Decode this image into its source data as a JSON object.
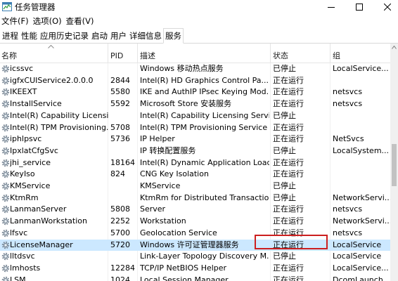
{
  "window": {
    "title": "任务管理器",
    "app_icon": "task-manager-icon",
    "controls": [
      "minimize-icon",
      "maximize-icon",
      "close-icon"
    ]
  },
  "menu": [
    "文件(F)",
    "选项(O)",
    "查看(V)"
  ],
  "tabs": [
    {
      "label": "进程",
      "active": false
    },
    {
      "label": "性能",
      "active": false
    },
    {
      "label": "应用历史记录",
      "active": false
    },
    {
      "label": "启动",
      "active": false
    },
    {
      "label": "用户",
      "active": false
    },
    {
      "label": "详细信息",
      "active": false
    },
    {
      "label": "服务",
      "active": true
    }
  ],
  "columns": {
    "name": "名称",
    "pid": "PID",
    "description": "描述",
    "status": "状态",
    "group": "组",
    "sorted_column": "name"
  },
  "rows": [
    {
      "name": "icssvc",
      "pid": "",
      "description": "Windows 移动热点服务",
      "status": "已停止",
      "group": "LocalService..."
    },
    {
      "name": "igfxCUIService2.0.0.0",
      "pid": "2844",
      "description": "Intel(R) HD Graphics Control Pa...",
      "status": "正在运行",
      "group": ""
    },
    {
      "name": "IKEEXT",
      "pid": "5580",
      "description": "IKE and AuthIP IPsec Keying Mod...",
      "status": "正在运行",
      "group": "netsvcs"
    },
    {
      "name": "InstallService",
      "pid": "5592",
      "description": "Microsoft Store 安装服务",
      "status": "正在运行",
      "group": "netsvcs"
    },
    {
      "name": "Intel(R) Capability Licensi...",
      "pid": "",
      "description": "Intel(R) Capability Licensing Servi...",
      "status": "已停止",
      "group": ""
    },
    {
      "name": "Intel(R) TPM Provisioning...",
      "pid": "5708",
      "description": "Intel(R) TPM Provisioning Service",
      "status": "正在运行",
      "group": ""
    },
    {
      "name": "iphlpsvc",
      "pid": "5736",
      "description": "IP Helper",
      "status": "正在运行",
      "group": "NetSvcs"
    },
    {
      "name": "IpxlatCfgSvc",
      "pid": "",
      "description": "IP 转换配置服务",
      "status": "已停止",
      "group": "LocalSystem..."
    },
    {
      "name": "jhi_service",
      "pid": "18164",
      "description": "Intel(R) Dynamic Application Load...",
      "status": "正在运行",
      "group": ""
    },
    {
      "name": "KeyIso",
      "pid": "824",
      "description": "CNG Key Isolation",
      "status": "正在运行",
      "group": ""
    },
    {
      "name": "KMService",
      "pid": "",
      "description": "KMService",
      "status": "已停止",
      "group": ""
    },
    {
      "name": "KtmRm",
      "pid": "",
      "description": "KtmRm for Distributed Transactio...",
      "status": "已停止",
      "group": "NetworkServi..."
    },
    {
      "name": "LanmanServer",
      "pid": "5808",
      "description": "Server",
      "status": "正在运行",
      "group": "netsvcs"
    },
    {
      "name": "LanmanWorkstation",
      "pid": "2252",
      "description": "Workstation",
      "status": "正在运行",
      "group": "NetworkServi..."
    },
    {
      "name": "lfsvc",
      "pid": "5700",
      "description": "Geolocation Service",
      "status": "正在运行",
      "group": "netsvcs"
    },
    {
      "name": "LicenseManager",
      "pid": "5720",
      "description": "Windows 许可证管理器服务",
      "status": "正在运行",
      "group": "LocalService",
      "selected": true
    },
    {
      "name": "lltdsvc",
      "pid": "",
      "description": "Link-Layer Topology Discovery M...",
      "status": "已停止",
      "group": "LocalService"
    },
    {
      "name": "lmhosts",
      "pid": "12284",
      "description": "TCP/IP NetBIOS Helper",
      "status": "正在运行",
      "group": "LocalService..."
    },
    {
      "name": "LSM",
      "pid": "1024",
      "description": "Local Session Manager",
      "status": "正在运行",
      "group": "DcomLaunch"
    }
  ],
  "colors": {
    "selected_row": "#cce8ff",
    "highlight_box": "#cc1f1f"
  }
}
